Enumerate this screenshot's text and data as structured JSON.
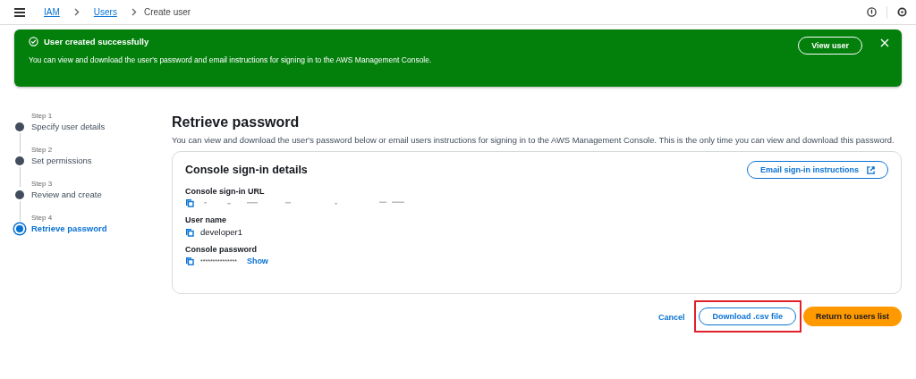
{
  "breadcrumbs": [
    {
      "label": "IAM",
      "link": true
    },
    {
      "label": "Users",
      "link": true
    },
    {
      "label": "Create user",
      "link": false
    }
  ],
  "flash": {
    "title": "User created successfully",
    "message": "You can view and download the user's password and email instructions for signing in to the AWS Management Console.",
    "action": "View user"
  },
  "steps": [
    {
      "step": "Step 1",
      "title": "Specify user details",
      "selected": false
    },
    {
      "step": "Step 2",
      "title": "Set permissions",
      "selected": false
    },
    {
      "step": "Step 3",
      "title": "Review and create",
      "selected": false
    },
    {
      "step": "Step 4",
      "title": "Retrieve password",
      "selected": true
    }
  ],
  "page": {
    "title": "Retrieve password",
    "description": "You can view and download the user's password below or email users instructions for signing in to the AWS Management Console. This is the only time you can view and download this password."
  },
  "card": {
    "title": "Console sign-in details",
    "action": "Email sign-in instructions",
    "fields": [
      {
        "label": "Console sign-in URL",
        "kind": "redacted"
      },
      {
        "label": "User name",
        "kind": "text",
        "value": "developer1"
      },
      {
        "label": "Console password",
        "kind": "secret",
        "value": "***************",
        "toggle": "Show"
      }
    ]
  },
  "buttons": [
    {
      "label": "Cancel",
      "kind": "link",
      "highlighted": false
    },
    {
      "label": "Download .csv file",
      "kind": "normal",
      "highlighted": true
    },
    {
      "label": "Return to users list",
      "kind": "primary",
      "highlighted": false
    }
  ]
}
